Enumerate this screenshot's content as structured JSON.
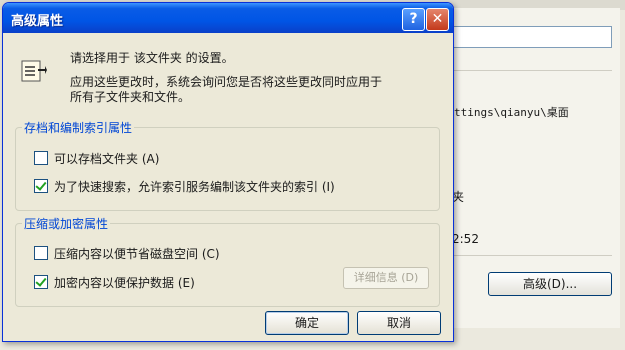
{
  "background_window": {
    "path_text": "ttings\\qianyu\\桌面",
    "partial_char": "夹",
    "partial_time": "2:52",
    "advanced_button": "高级(D)..."
  },
  "dialog": {
    "title": "高级属性",
    "help_label": "?",
    "close_label": "✕",
    "info_line1": "请选择用于 该文件夹 的设置。",
    "info_line2": "应用这些更改时，系统会询问您是否将这些更改同时应用于",
    "info_line3": "所有子文件夹和文件。",
    "archive_group": {
      "legend": "存档和编制索引属性",
      "options": [
        {
          "label": "可以存档文件夹 (A)",
          "checked": false
        },
        {
          "label": "为了快速搜索，允许索引服务编制该文件夹的索引 (I)",
          "checked": true
        }
      ]
    },
    "compress_group": {
      "legend": "压缩或加密属性",
      "options": [
        {
          "label": "压缩内容以便节省磁盘空间 (C)",
          "checked": false
        },
        {
          "label": "加密内容以便保护数据 (E)",
          "checked": true
        }
      ],
      "details_button": "详细信息 (D)"
    },
    "ok_button": "确定",
    "cancel_button": "取消"
  }
}
